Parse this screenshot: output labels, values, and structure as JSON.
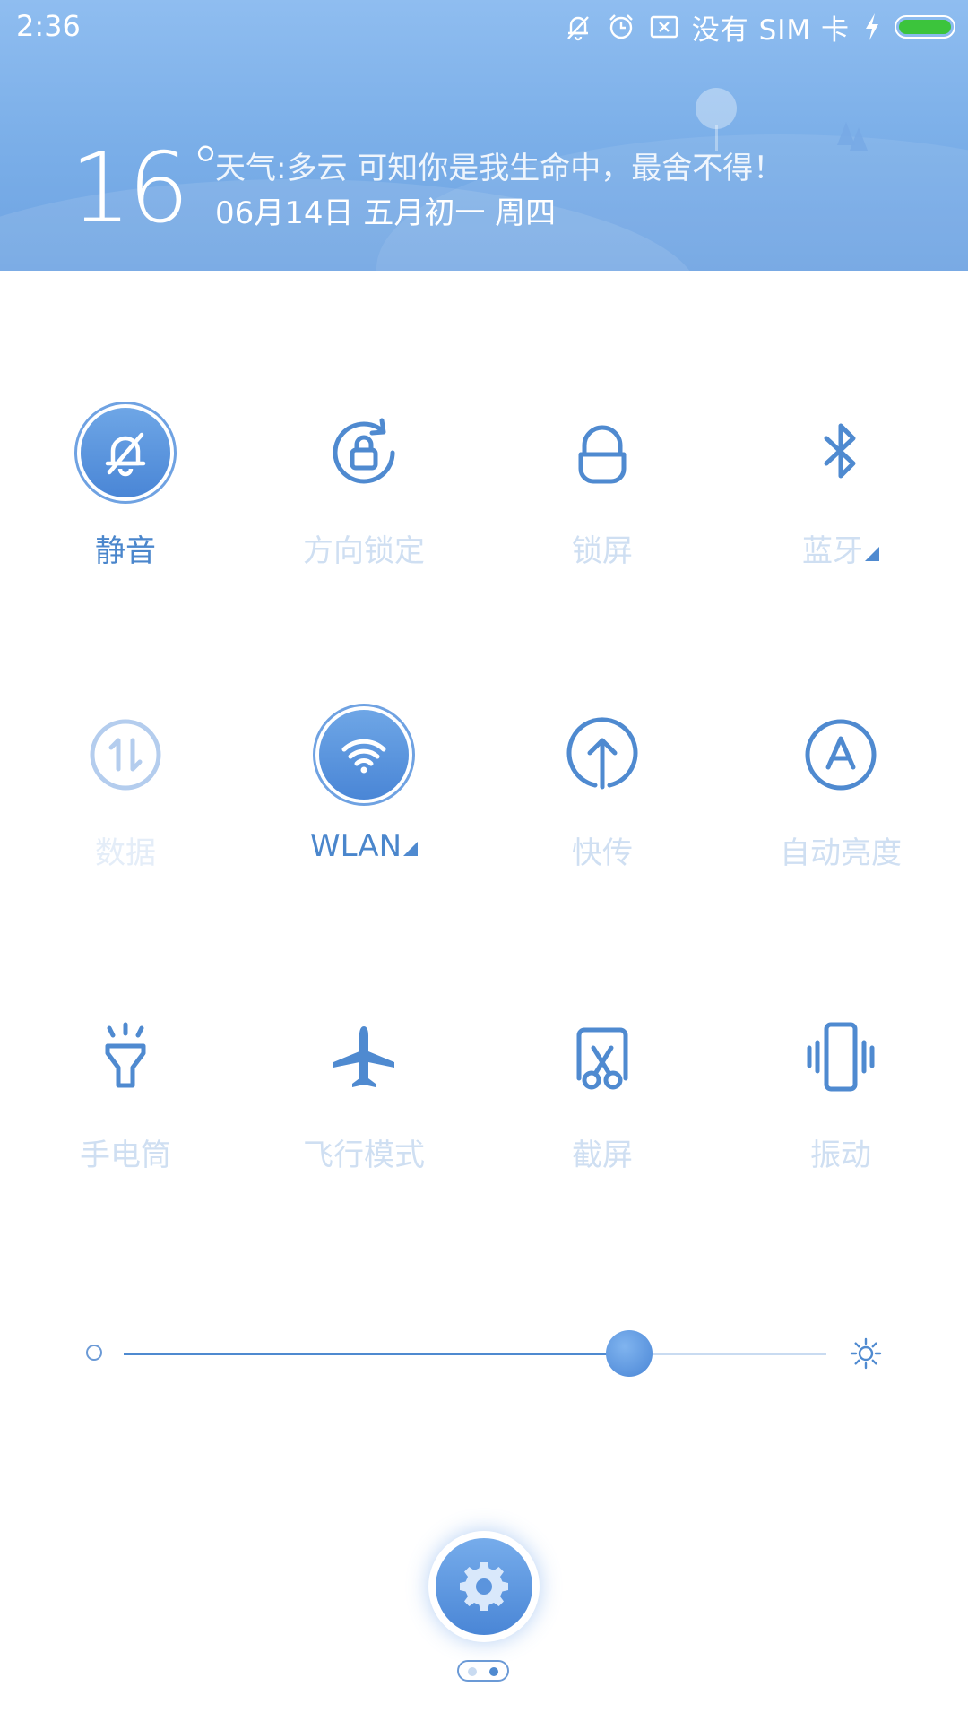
{
  "status_bar": {
    "time": "2:36",
    "carrier": "没有 SIM 卡",
    "battery_level": 1.0,
    "battery_color": "#3cc43c",
    "icons": [
      "mute-bell-icon",
      "alarm-icon",
      "no-sim-icon",
      "charging-bolt-icon",
      "battery-icon"
    ]
  },
  "weather": {
    "temperature": "16",
    "degree_symbol": "°",
    "line1": "天气:多云  可知你是我生命中，最舍不得！",
    "line2": "06月14日 五月初一 周四"
  },
  "toggles": [
    {
      "label": "静音",
      "icon": "mute-bell-icon",
      "on": true
    },
    {
      "label": "方向锁定",
      "icon": "rotation-lock-icon",
      "on": false
    },
    {
      "label": "锁屏",
      "icon": "lock-icon",
      "on": false
    },
    {
      "label": "蓝牙",
      "icon": "bluetooth-icon",
      "on": false,
      "has_menu": true
    },
    {
      "label": "数据",
      "icon": "mobile-data-icon",
      "on": false,
      "disabled": true
    },
    {
      "label": "WLAN",
      "icon": "wifi-icon",
      "on": true,
      "has_menu": true
    },
    {
      "label": "快传",
      "icon": "quick-transfer-icon",
      "on": false
    },
    {
      "label": "自动亮度",
      "icon": "auto-brightness-icon",
      "on": false
    },
    {
      "label": "手电筒",
      "icon": "flashlight-icon",
      "on": false
    },
    {
      "label": "飞行模式",
      "icon": "airplane-icon",
      "on": false
    },
    {
      "label": "截屏",
      "icon": "screenshot-icon",
      "on": false
    },
    {
      "label": "振动",
      "icon": "vibrate-icon",
      "on": false
    }
  ],
  "brightness": {
    "level": 0.72
  },
  "settings": {
    "icon": "gear-icon"
  },
  "pager": {
    "pages": 2,
    "current": 2
  },
  "colors": {
    "accent": "#4a86d6",
    "label_on": "#4a86cc",
    "label_off": "#cfdff2",
    "header_top": "#8fbdf0",
    "header_bottom": "#6ea3e2"
  }
}
